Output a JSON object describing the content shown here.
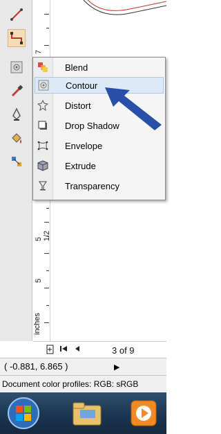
{
  "toolbox": {
    "tools": [
      {
        "name": "dimension-tool-icon",
        "active": false
      },
      {
        "name": "connector-tool-icon",
        "active": true
      },
      {
        "name": "interactive-effects-tool-icon",
        "active": false
      },
      {
        "name": "eyedropper-tool-icon",
        "active": false
      },
      {
        "name": "outline-pen-tool-icon",
        "active": false
      },
      {
        "name": "fill-tool-icon",
        "active": false
      },
      {
        "name": "interactive-fill-tool-icon",
        "active": false
      }
    ]
  },
  "ruler": {
    "labels": [
      "7",
      "5 1/2",
      "5"
    ]
  },
  "flyout": {
    "items": [
      {
        "label": "Blend",
        "icon": "blend-icon",
        "highlighted": false
      },
      {
        "label": "Contour",
        "icon": "contour-icon",
        "highlighted": true
      },
      {
        "label": "Distort",
        "icon": "distort-icon",
        "highlighted": false
      },
      {
        "label": "Drop Shadow",
        "icon": "drop-shadow-icon",
        "highlighted": false
      },
      {
        "label": "Envelope",
        "icon": "envelope-icon",
        "highlighted": false
      },
      {
        "label": "Extrude",
        "icon": "extrude-icon",
        "highlighted": false
      },
      {
        "label": "Transparency",
        "icon": "transparency-icon",
        "highlighted": false
      }
    ]
  },
  "pagebar": {
    "units": "inches",
    "page_text": "3 of 9"
  },
  "coords": {
    "value": "( -0.881, 6.865 )"
  },
  "status": {
    "text": "Document color profiles: RGB: sRGB"
  },
  "colors": {
    "accent": "#2a4fa8",
    "highlight": "#dbe9f8",
    "toolActive": "#f7dbb7"
  }
}
